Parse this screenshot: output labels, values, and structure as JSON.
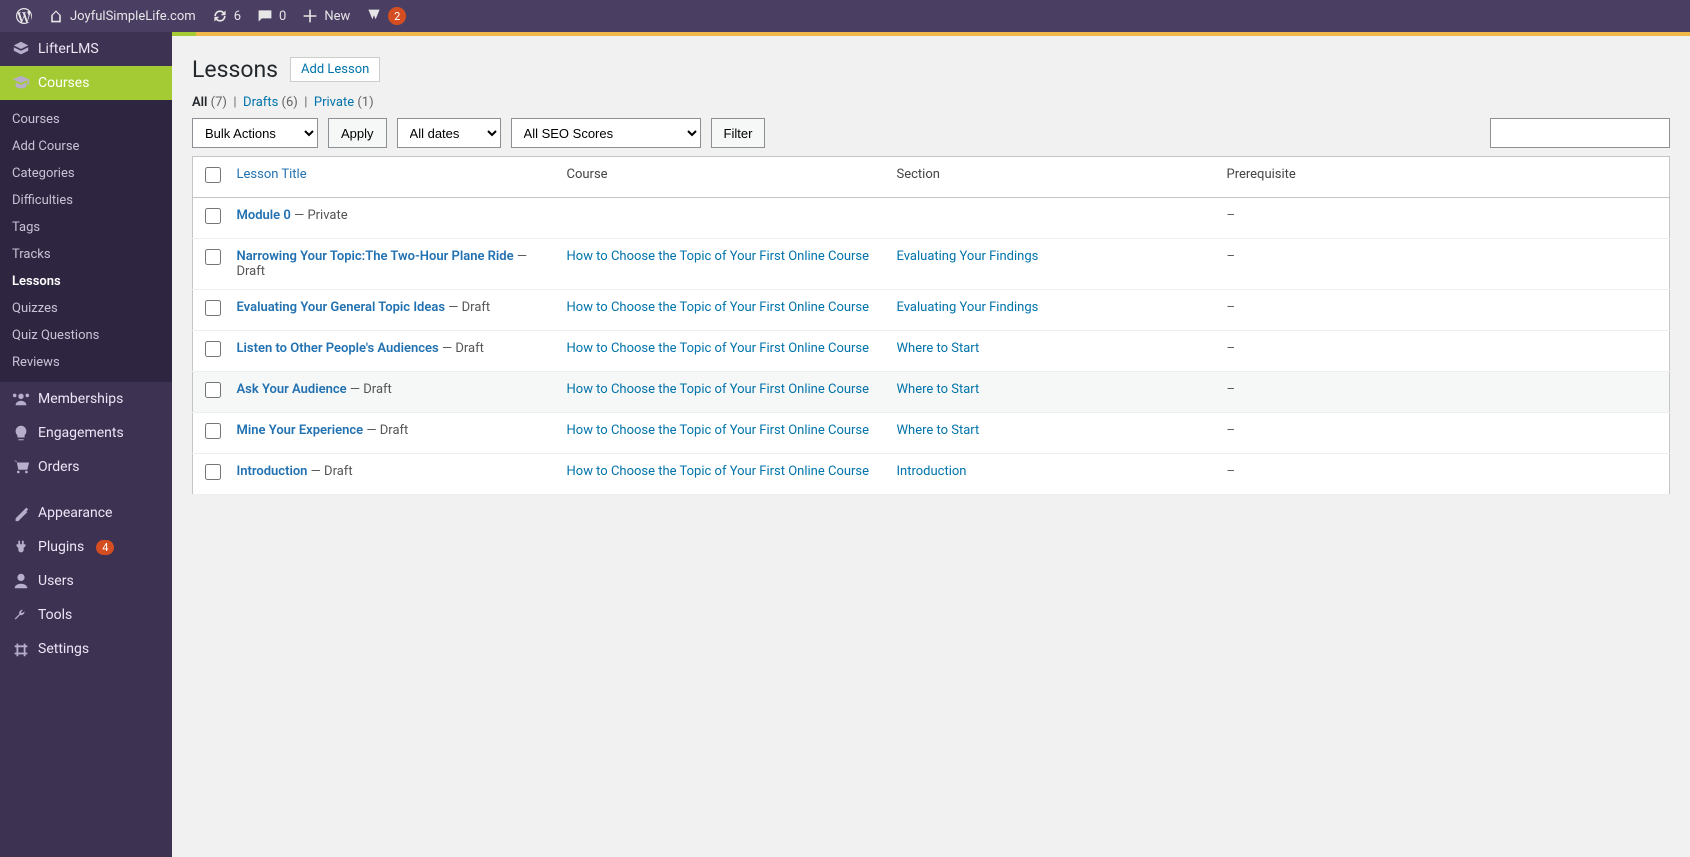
{
  "adminbar": {
    "site_title": "JoyfulSimpleLife.com",
    "updates_count": "6",
    "comments_count": "0",
    "new_label": "New",
    "yoast_count": "2"
  },
  "sidebar": {
    "lifter_label": "LifterLMS",
    "courses_label": "Courses",
    "submenu": [
      {
        "label": "Courses"
      },
      {
        "label": "Add Course"
      },
      {
        "label": "Categories"
      },
      {
        "label": "Difficulties"
      },
      {
        "label": "Tags"
      },
      {
        "label": "Tracks"
      },
      {
        "label": "Lessons",
        "current": true
      },
      {
        "label": "Quizzes"
      },
      {
        "label": "Quiz Questions"
      },
      {
        "label": "Reviews"
      }
    ],
    "menus": [
      {
        "id": "memberships",
        "label": "Memberships"
      },
      {
        "id": "engagements",
        "label": "Engagements"
      },
      {
        "id": "orders",
        "label": "Orders"
      },
      {
        "id": "appearance",
        "label": "Appearance"
      },
      {
        "id": "plugins",
        "label": "Plugins",
        "count": "4"
      },
      {
        "id": "users",
        "label": "Users"
      },
      {
        "id": "tools",
        "label": "Tools"
      },
      {
        "id": "settings",
        "label": "Settings"
      }
    ]
  },
  "page": {
    "title": "Lessons",
    "add_button": "Add Lesson"
  },
  "subsubsub": {
    "all_label": "All",
    "all_count": "(7)",
    "drafts_label": "Drafts",
    "drafts_count": "(6)",
    "private_label": "Private",
    "private_count": "(1)"
  },
  "filters": {
    "bulk_actions": "Bulk Actions",
    "apply": "Apply",
    "all_dates": "All dates",
    "all_seo": "All SEO Scores",
    "filter": "Filter"
  },
  "columns": {
    "title": "Lesson Title",
    "course": "Course",
    "section": "Section",
    "prereq": "Prerequisite"
  },
  "rows": [
    {
      "title": "Module 0",
      "state": "Private",
      "course": "",
      "section": "",
      "prereq": "–"
    },
    {
      "title": "Narrowing Your Topic:The Two-Hour Plane Ride",
      "state": "Draft",
      "course": "How to Choose the Topic of Your First Online Course",
      "section": "Evaluating Your Findings",
      "prereq": "–"
    },
    {
      "title": "Evaluating Your General Topic Ideas",
      "state": "Draft",
      "course": "How to Choose the Topic of Your First Online Course",
      "section": "Evaluating Your Findings",
      "prereq": "–"
    },
    {
      "title": "Listen to Other People's Audiences",
      "state": "Draft",
      "course": "How to Choose the Topic of Your First Online Course",
      "section": "Where to Start",
      "prereq": "–"
    },
    {
      "title": "Ask Your Audience",
      "state": "Draft",
      "course": "How to Choose the Topic of Your First Online Course",
      "section": "Where to Start",
      "prereq": "–",
      "alt": true
    },
    {
      "title": "Mine Your Experience",
      "state": "Draft",
      "course": "How to Choose the Topic of Your First Online Course",
      "section": "Where to Start",
      "prereq": "–"
    },
    {
      "title": "Introduction",
      "state": "Draft",
      "course": "How to Choose the Topic of Your First Online Course",
      "section": "Introduction",
      "prereq": "–"
    }
  ]
}
